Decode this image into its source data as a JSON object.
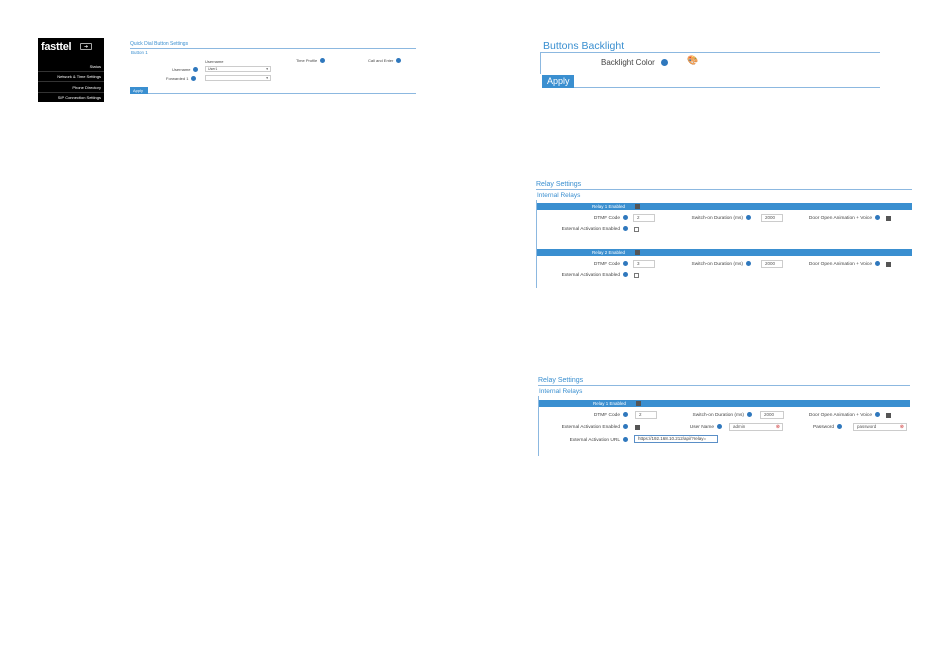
{
  "brand": "fasttel",
  "logout_icon": "logout-icon",
  "sidebar": {
    "items": [
      {
        "label": "Status"
      },
      {
        "label": "Network & Time Settings"
      },
      {
        "label": "Phone Directory"
      },
      {
        "label": "SIP Connection Settings"
      }
    ]
  },
  "quick_dial": {
    "title": "Quick Dial Button Settings",
    "subtitle": "Button 1",
    "col_username": "Username",
    "col_time_profile": "Time Profile",
    "col_call_enter": "Call and Enter",
    "row1_label": "Username",
    "row1_value": "User1",
    "row2_label": "Forwarded 1",
    "apply": "Apply"
  },
  "backlight": {
    "title": "Buttons Backlight",
    "label": "Backlight Color",
    "icon": "palette-icon",
    "apply": "Apply"
  },
  "relay1": {
    "title": "Relay Settings",
    "subtitle": "Internal Relays",
    "r1_header": "Relay 1 Enabled",
    "dtmf_label": "DTMF Code",
    "r1_dtmf": "2",
    "switch_label": "Switch-on Duration (ms)",
    "r1_switch": "2000",
    "door_label": "Door Open Animation + Voice",
    "ext_label": "External Activation Enabled",
    "r2_header": "Relay 2 Enabled",
    "r2_dtmf": "3",
    "r2_switch": "2000"
  },
  "relay2": {
    "title": "Relay Settings",
    "subtitle": "Internal Relays",
    "r1_header": "Relay 1 Enabled",
    "dtmf_label": "DTMF Code",
    "dtmf": "2",
    "switch_label": "Switch-on Duration (ms)",
    "switch": "2000",
    "door_label": "Door Open Animation + Voice",
    "ext_label": "External Activation Enabled",
    "user_label": "User Name",
    "user_value": "admin",
    "pass_label": "Password",
    "pass_value": "password",
    "url_label": "External Activation URL",
    "url_value": "https://192.168.10.212/api/?relay="
  }
}
